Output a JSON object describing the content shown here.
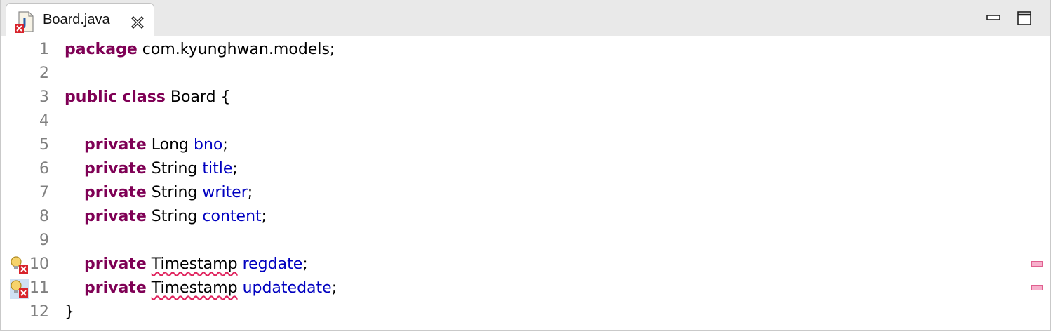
{
  "tab": {
    "file_name": "Board.java",
    "file_icon": "java-file-error-icon",
    "close_icon": "close-icon"
  },
  "window_controls": {
    "minimize_icon": "minimize-icon",
    "maximize_icon": "maximize-icon"
  },
  "colors": {
    "keyword": "#7f0055",
    "field": "#0000c0",
    "error_underline": "#e0245e",
    "line_number": "#808080"
  },
  "code": {
    "lines": [
      {
        "num": "1",
        "tokens": [
          {
            "t": "package",
            "c": "kw"
          },
          {
            "t": " com.kyunghwan.models;",
            "c": ""
          }
        ]
      },
      {
        "num": "2",
        "tokens": []
      },
      {
        "num": "3",
        "tokens": [
          {
            "t": "public",
            "c": "kw"
          },
          {
            "t": " ",
            "c": ""
          },
          {
            "t": "class",
            "c": "kw"
          },
          {
            "t": " Board {",
            "c": ""
          }
        ]
      },
      {
        "num": "4",
        "tokens": []
      },
      {
        "num": "5",
        "tokens": [
          {
            "t": "    ",
            "c": ""
          },
          {
            "t": "private",
            "c": "kw"
          },
          {
            "t": " Long ",
            "c": ""
          },
          {
            "t": "bno",
            "c": "field"
          },
          {
            "t": ";",
            "c": ""
          }
        ]
      },
      {
        "num": "6",
        "tokens": [
          {
            "t": "    ",
            "c": ""
          },
          {
            "t": "private",
            "c": "kw"
          },
          {
            "t": " String ",
            "c": ""
          },
          {
            "t": "title",
            "c": "field"
          },
          {
            "t": ";",
            "c": ""
          }
        ]
      },
      {
        "num": "7",
        "tokens": [
          {
            "t": "    ",
            "c": ""
          },
          {
            "t": "private",
            "c": "kw"
          },
          {
            "t": " String ",
            "c": ""
          },
          {
            "t": "writer",
            "c": "field"
          },
          {
            "t": ";",
            "c": ""
          }
        ]
      },
      {
        "num": "8",
        "tokens": [
          {
            "t": "    ",
            "c": ""
          },
          {
            "t": "private",
            "c": "kw"
          },
          {
            "t": " String ",
            "c": ""
          },
          {
            "t": "content",
            "c": "field"
          },
          {
            "t": ";",
            "c": ""
          }
        ]
      },
      {
        "num": "9",
        "tokens": []
      },
      {
        "num": "10",
        "error": true,
        "gutter_icon": "quickfix-error-icon",
        "tokens": [
          {
            "t": "    ",
            "c": ""
          },
          {
            "t": "private",
            "c": "kw"
          },
          {
            "t": " ",
            "c": ""
          },
          {
            "t": "Timestamp",
            "c": "err"
          },
          {
            "t": " ",
            "c": ""
          },
          {
            "t": "regdate",
            "c": "field"
          },
          {
            "t": ";",
            "c": ""
          }
        ]
      },
      {
        "num": "11",
        "error": true,
        "gutter_icon": "quickfix-error-icon",
        "tokens": [
          {
            "t": "    ",
            "c": ""
          },
          {
            "t": "private",
            "c": "kw"
          },
          {
            "t": " ",
            "c": ""
          },
          {
            "t": "Timestamp",
            "c": "err"
          },
          {
            "t": " ",
            "c": ""
          },
          {
            "t": "updatedate",
            "c": "field"
          },
          {
            "t": ";",
            "c": ""
          }
        ]
      },
      {
        "num": "12",
        "tokens": [
          {
            "t": "}",
            "c": ""
          }
        ]
      }
    ]
  },
  "overview_ruler": {
    "error_markers": [
      "line-10",
      "line-11"
    ]
  }
}
